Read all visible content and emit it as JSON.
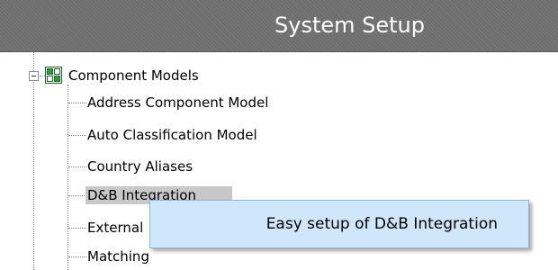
{
  "header": {
    "title": "System Setup"
  },
  "tree": {
    "root": {
      "label": "Component Models",
      "icon": "component-models-icon",
      "expanded": true
    },
    "children": [
      {
        "label": "Address Component Model"
      },
      {
        "label": "Auto Classification Model"
      },
      {
        "label": "Country Aliases"
      },
      {
        "label": "D&B Integration",
        "selected": true
      },
      {
        "label": "External"
      },
      {
        "label": "Matching"
      }
    ]
  },
  "context_menu": {
    "items": [
      {
        "label": "Easy setup of D&B Integration"
      }
    ]
  },
  "colors": {
    "header_bg": "#6e6e6e",
    "selection_bg": "#c8c8c8",
    "menu_bg": "#cfe6fb",
    "menu_border": "#8fb6dc"
  }
}
